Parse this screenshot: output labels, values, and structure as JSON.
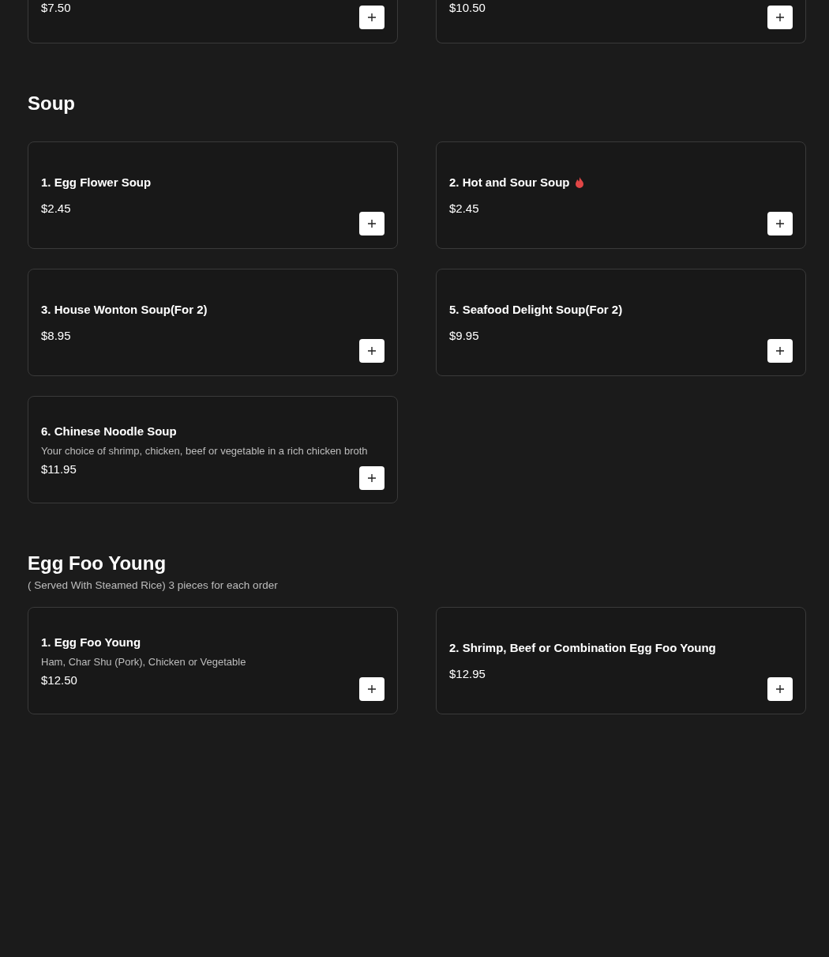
{
  "sections": [
    {
      "items": [
        {
          "price": "$7.50"
        },
        {
          "price": "$10.50"
        }
      ]
    },
    {
      "title": "Soup",
      "items": [
        {
          "name": "1. Egg Flower Soup",
          "price": "$2.45",
          "spicy": false
        },
        {
          "name": "2. Hot and Sour Soup",
          "price": "$2.45",
          "spicy": true
        },
        {
          "name": "3. House Wonton Soup(For 2)",
          "price": "$8.95",
          "spicy": false
        },
        {
          "name": "5. Seafood Delight Soup(For 2)",
          "price": "$9.95",
          "spicy": false
        },
        {
          "name": "6. Chinese Noodle Soup",
          "description": "Your choice of shrimp, chicken, beef or vegetable in a rich chicken broth",
          "price": "$11.95",
          "spicy": false
        }
      ]
    },
    {
      "title": "Egg Foo Young",
      "subtitle": "( Served With Steamed Rice) 3 pieces for each order",
      "items": [
        {
          "name": "1. Egg Foo Young",
          "description": "Ham, Char Shu (Pork), Chicken or Vegetable",
          "price": "$12.50",
          "spicy": false
        },
        {
          "name": "2. Shrimp, Beef or Combination Egg Foo Young",
          "price": "$12.95",
          "spicy": false
        }
      ]
    }
  ]
}
